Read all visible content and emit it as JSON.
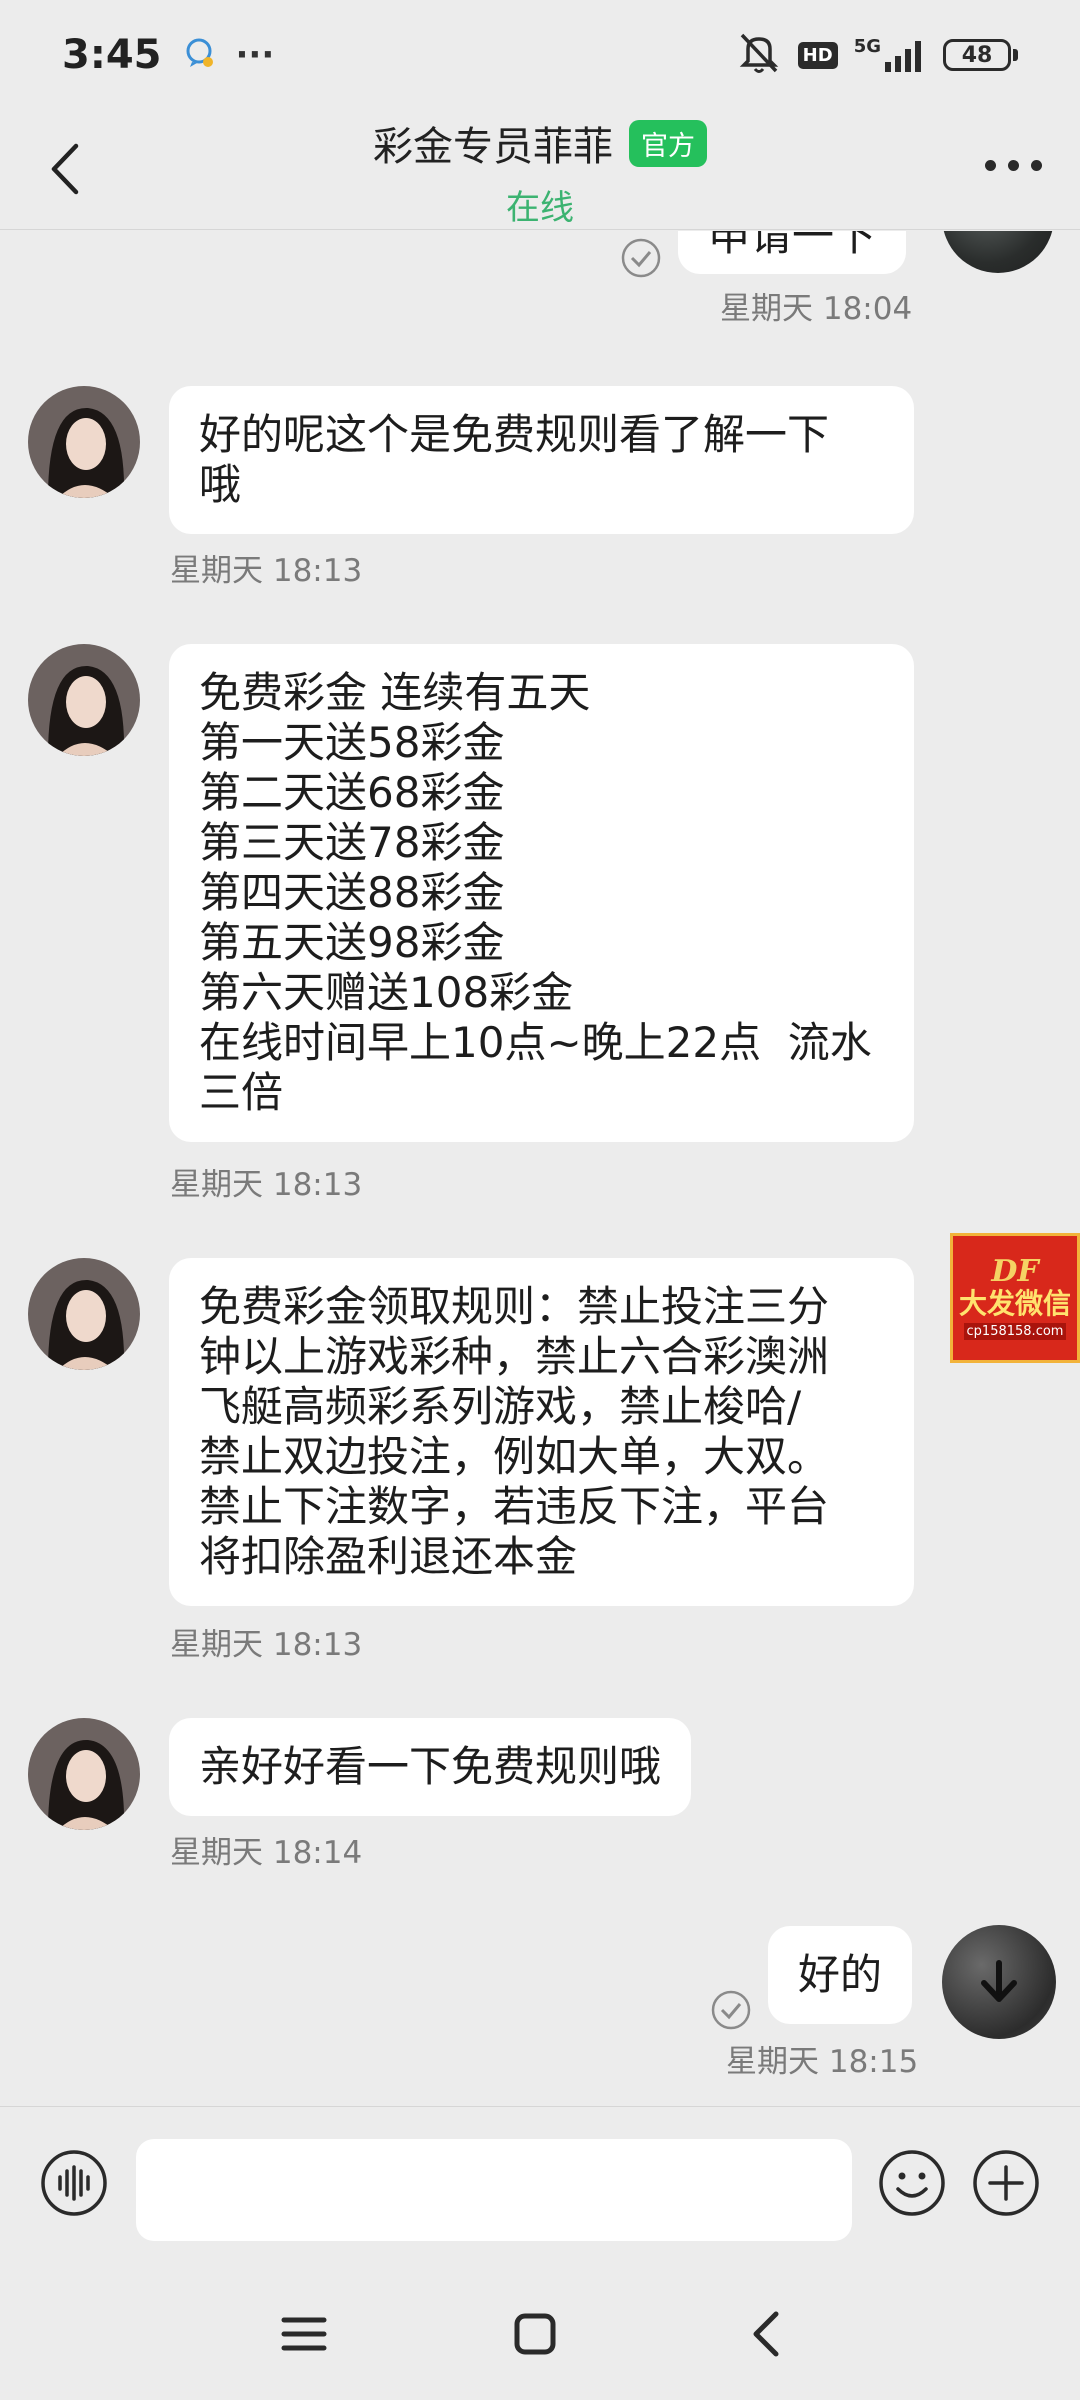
{
  "status_bar": {
    "time": "3:45",
    "more": "···",
    "hd": "HD",
    "network": "5G",
    "battery": "48"
  },
  "header": {
    "title": "彩金专员菲菲",
    "badge": "官方",
    "status": "在线"
  },
  "messages": [
    {
      "side": "right",
      "text": "申请一下",
      "time": "星期天 18:04"
    },
    {
      "side": "left",
      "lines": [
        "好的呢这个是免费规则看了解一下",
        "哦"
      ],
      "time": "星期天 18:13"
    },
    {
      "side": "left",
      "lines": [
        "免费彩金 连续有五天",
        "第一天送58彩金",
        "第二天送68彩金",
        "第三天送78彩金",
        "第四天送88彩金",
        "第五天送98彩金",
        "第六天赠送108彩金",
        "在线时间早上10点~晚上22点  流水",
        "三倍"
      ],
      "time": "星期天 18:13"
    },
    {
      "side": "left",
      "lines": [
        "免费彩金领取规则：禁止投注三分",
        "钟以上游戏彩种，禁止六合彩澳洲",
        "飞艇高频彩系列游戏，禁止梭哈/",
        "禁止双边投注，例如大单，大双。",
        "禁止下注数字，若违反下注，平台",
        "将扣除盈利退还本金"
      ],
      "time": "星期天 18:13"
    },
    {
      "side": "left",
      "text": "亲好好看一下免费规则哦",
      "time": "星期天 18:14"
    },
    {
      "side": "right",
      "text": "好的",
      "time": "星期天 18:15"
    }
  ],
  "promo": {
    "logo": "DF",
    "title": "大发微信",
    "url": "cp158158.com"
  },
  "input": {
    "placeholder": "",
    "value": ""
  },
  "icons": {
    "back": "back-arrow-icon",
    "more": "more-dots-icon",
    "voice": "voice-wave-icon",
    "emoji": "emoji-icon",
    "plus": "plus-icon",
    "check": "sent-check-icon"
  },
  "colors": {
    "accent_green": "#25c05c",
    "online_green": "#3cb371",
    "background": "#ececec",
    "bubble": "#ffffff"
  }
}
